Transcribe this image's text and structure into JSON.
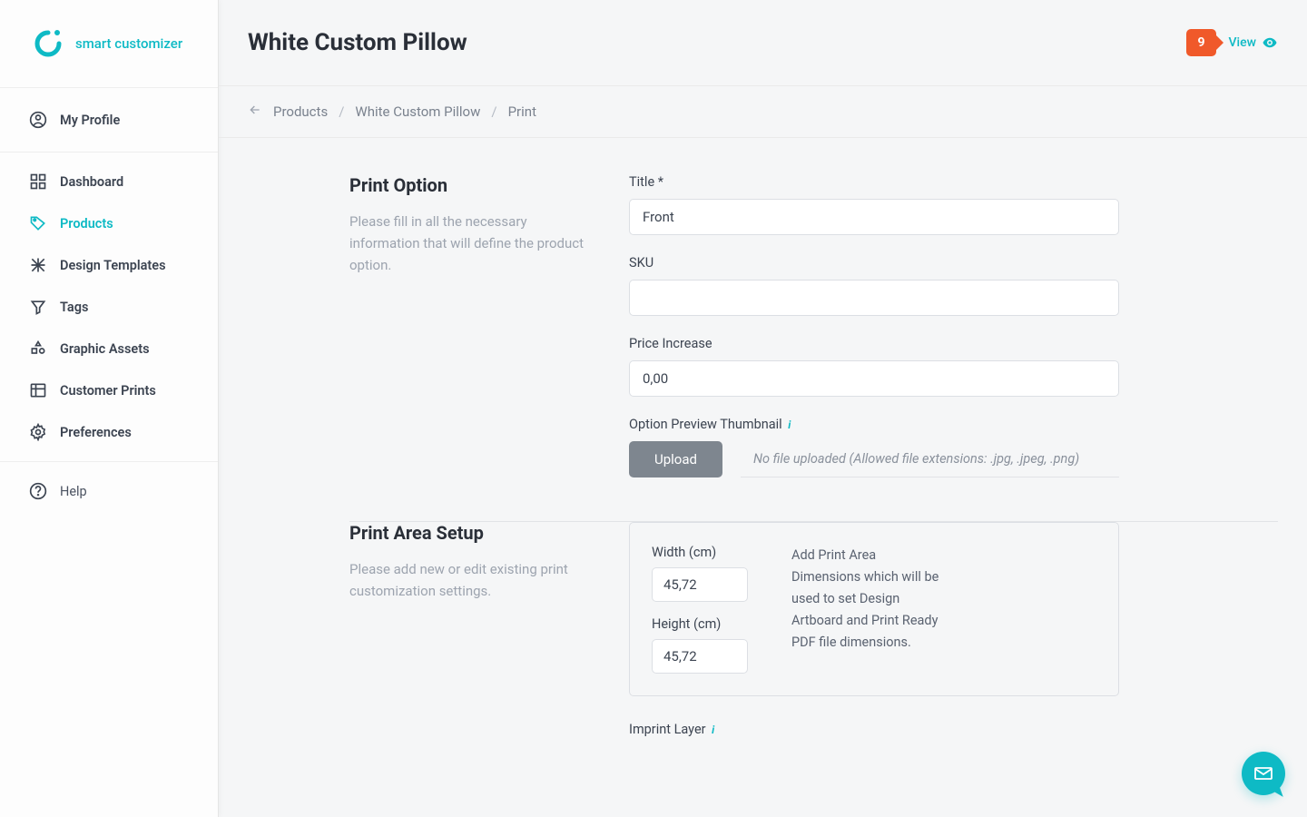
{
  "brand": "smart customizer",
  "sidebar": {
    "profile_label": "My Profile",
    "items": [
      {
        "label": "Dashboard"
      },
      {
        "label": "Products"
      },
      {
        "label": "Design Templates"
      },
      {
        "label": "Tags"
      },
      {
        "label": "Graphic Assets"
      },
      {
        "label": "Customer Prints"
      },
      {
        "label": "Preferences"
      }
    ],
    "help_label": "Help"
  },
  "header": {
    "title": "White Custom Pillow",
    "badge": "9",
    "view_label": "View"
  },
  "breadcrumb": {
    "items": [
      "Products",
      "White Custom Pillow",
      "Print"
    ]
  },
  "print_option": {
    "section_title": "Print Option",
    "section_desc": "Please fill in all the necessary information that will define the product option.",
    "title_label": "Title *",
    "title_value": "Front",
    "sku_label": "SKU",
    "sku_value": "",
    "price_label": "Price Increase",
    "price_value": "0,00",
    "thumbnail_label": "Option Preview Thumbnail",
    "upload_label": "Upload",
    "upload_placeholder": "No file uploaded (Allowed file extensions: .jpg, .jpeg, .png)"
  },
  "print_area": {
    "section_title": "Print Area Setup",
    "section_desc": "Please add new or edit existing print customization settings.",
    "width_label": "Width (cm)",
    "width_value": "45,72",
    "height_label": "Height (cm)",
    "height_value": "45,72",
    "box_desc": "Add Print Area Dimensions which will be used to set Design Artboard and Print Ready PDF file dimensions.",
    "imprint_label": "Imprint Layer"
  }
}
